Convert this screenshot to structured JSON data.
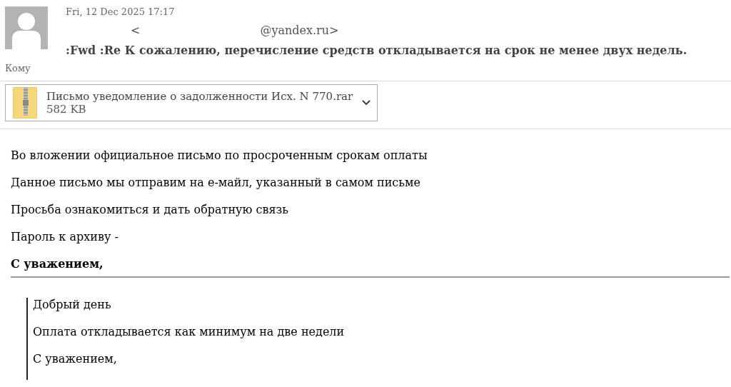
{
  "header": {
    "date": "Fri, 12 Dec 2025 17:17",
    "sender_open": "<",
    "sender_address": "@yandex.ru>",
    "subject": ":Fwd :Re К сожалению, перечисление средств откладывается на срок не менее двух недель.",
    "to_label": "Кому"
  },
  "attachment": {
    "name": "Письмо уведомление о задолженности Исх. N 770.rar",
    "size": "582 KB"
  },
  "body": [
    {
      "text": "Во вложении официальное письмо по просроченным срокам оплаты",
      "bold": false
    },
    {
      "text": "Данное письмо мы отправим на е-майл, указанный в самом письме",
      "bold": false
    },
    {
      "text": "Просьба ознакомиться и дать обратную связь",
      "bold": false
    },
    {
      "text": "Пароль к архиву -",
      "bold": false
    },
    {
      "text": "С уважением,",
      "bold": true
    }
  ],
  "quote": [
    "Добрый день",
    "Оплата откладывается как минимум на две недели",
    "С уважением,"
  ]
}
